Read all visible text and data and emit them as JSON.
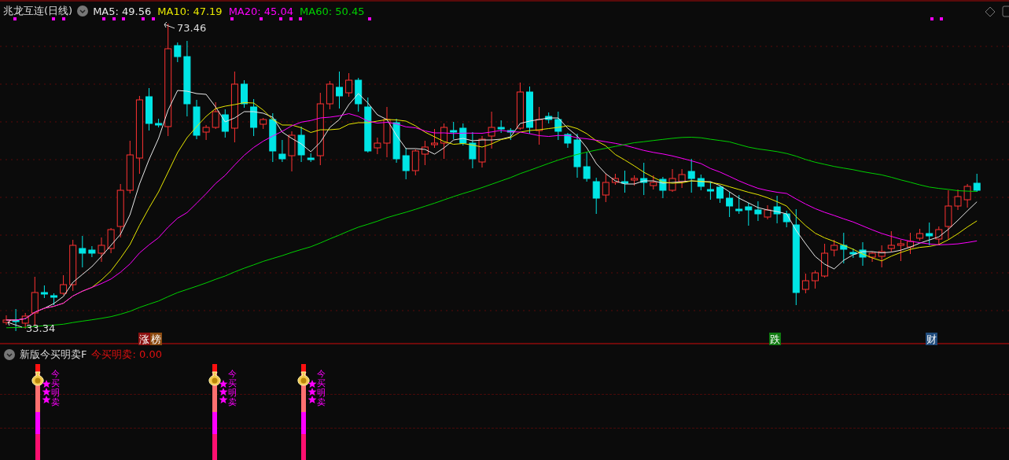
{
  "header": {
    "title": "兆龙互连(日线)",
    "ma_readings": [
      {
        "label": "MA5: 49.56",
        "color": "#e8e8e8"
      },
      {
        "label": "MA10: 47.19",
        "color": "#e8e800"
      },
      {
        "label": "MA20: 45.04",
        "color": "#ff00ff"
      },
      {
        "label": "MA60: 50.45",
        "color": "#00d000"
      }
    ]
  },
  "price_labels": {
    "high": "73.46",
    "low": "33.34"
  },
  "event_tags": [
    {
      "text": "涨",
      "color": "#8c1010"
    },
    {
      "text": "榜",
      "color": "#8a4a10"
    },
    {
      "text": "跌",
      "color": "#0f7a10"
    },
    {
      "text": "财",
      "color": "#1f4a7a"
    }
  ],
  "indicator": {
    "title": "新版今买明卖F",
    "reading": "今买明卖: 0.00",
    "signals": [
      {
        "text": "今买明卖"
      },
      {
        "text": "今买明卖"
      },
      {
        "text": "今买明卖"
      }
    ]
  }
}
